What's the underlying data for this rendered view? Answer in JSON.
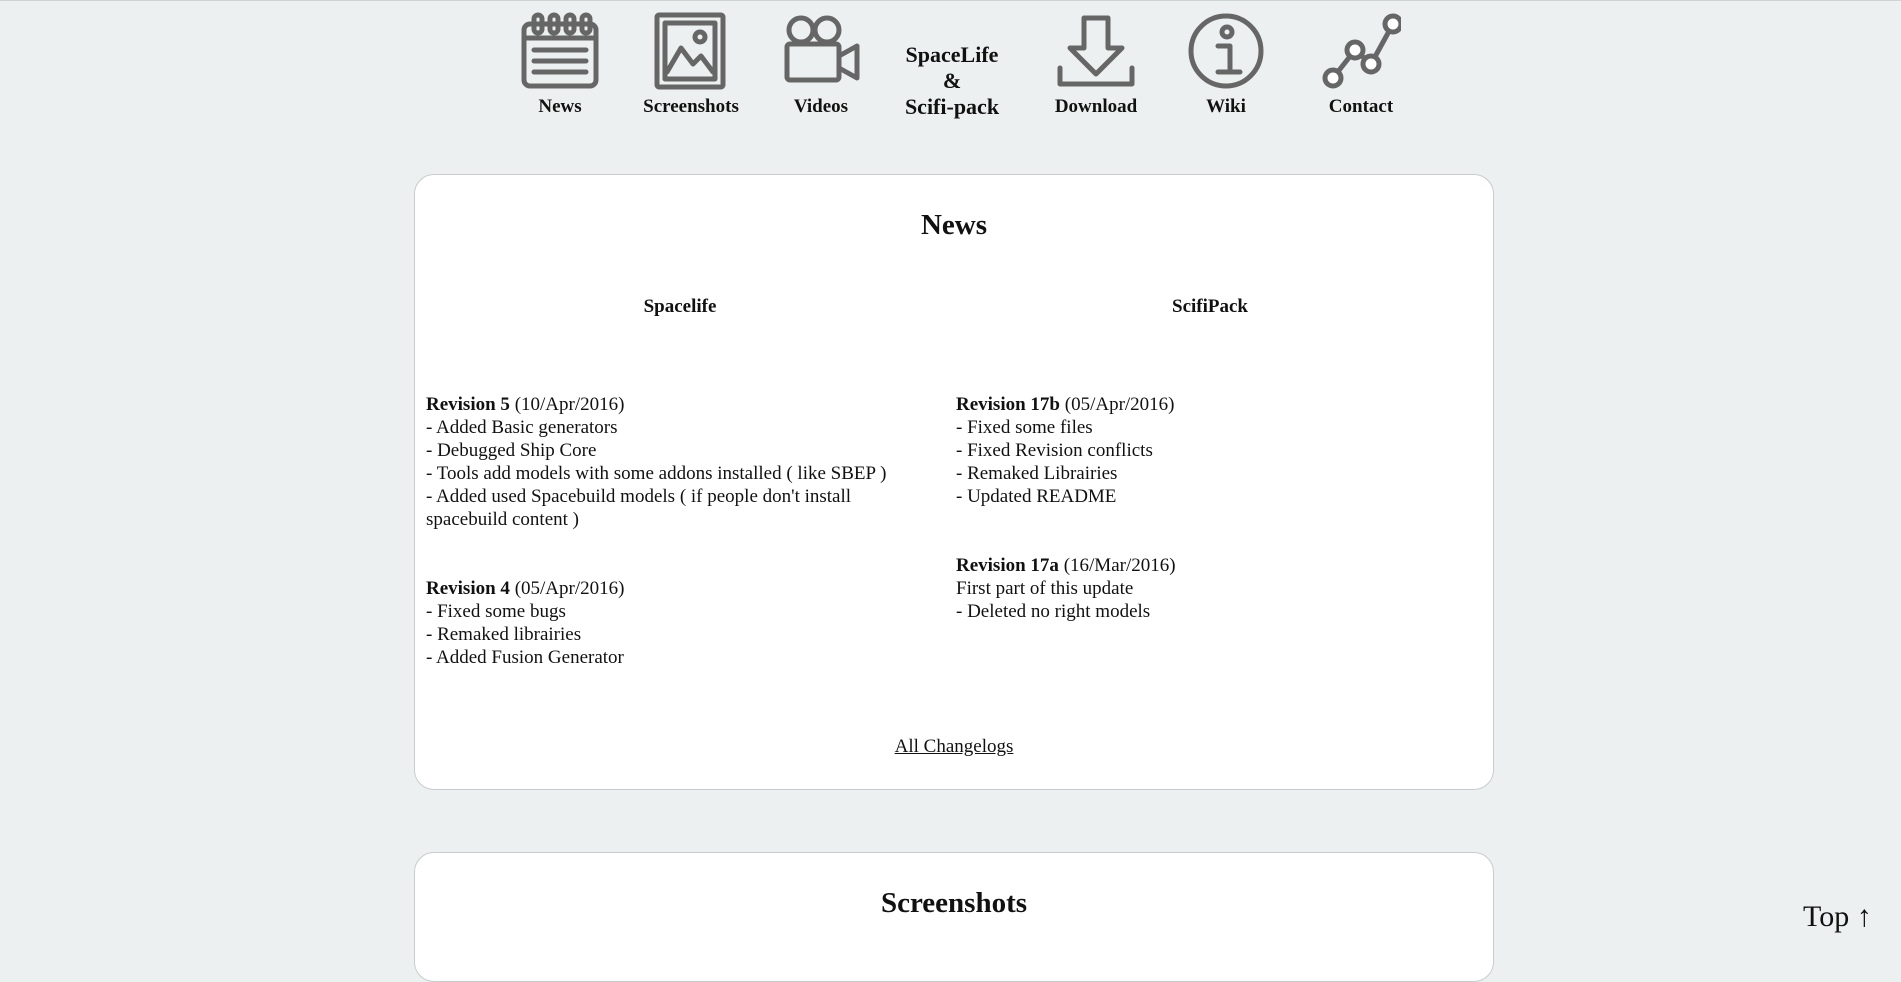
{
  "nav": {
    "items": [
      {
        "label": "News",
        "icon": "calendar-icon"
      },
      {
        "label": "Screenshots",
        "icon": "picture-icon"
      },
      {
        "label": "Videos",
        "icon": "video-camera-icon"
      },
      {
        "label": "Download",
        "icon": "download-icon"
      },
      {
        "label": "Wiki",
        "icon": "info-icon"
      },
      {
        "label": "Contact",
        "icon": "network-icon"
      }
    ],
    "brand": {
      "line1": "SpaceLife",
      "line2": "&",
      "line3": "Scifi-pack"
    }
  },
  "news": {
    "title": "News",
    "spacelife": {
      "heading": "Spacelife",
      "entries": [
        {
          "revision": "Revision 5",
          "date": "(10/Apr/2016)",
          "lines": [
            "- Added Basic generators",
            "- Debugged Ship Core",
            "- Tools add models with some addons installed ( like SBEP )",
            "- Added used Spacebuild models ( if people don't install spacebuild content )"
          ]
        },
        {
          "revision": "Revision 4",
          "date": "(05/Apr/2016)",
          "lines": [
            "- Fixed some bugs",
            "- Remaked librairies",
            "- Added Fusion Generator"
          ]
        }
      ]
    },
    "scifipack": {
      "heading": "ScifiPack",
      "entries": [
        {
          "revision": "Revision 17b",
          "date": "(05/Apr/2016)",
          "lines": [
            "- Fixed some files",
            "- Fixed Revision conflicts",
            "- Remaked Librairies",
            "- Updated README"
          ]
        },
        {
          "revision": "Revision 17a",
          "date": "(16/Mar/2016)",
          "lines": [
            "First part of this update",
            "- Deleted no right models"
          ]
        }
      ]
    },
    "all_changelogs": "All Changelogs"
  },
  "screenshots": {
    "title": "Screenshots"
  },
  "top_link": "Top ↑",
  "colors": {
    "background": "#edf0f0",
    "card": "#ffffff",
    "icon": "#666666"
  }
}
